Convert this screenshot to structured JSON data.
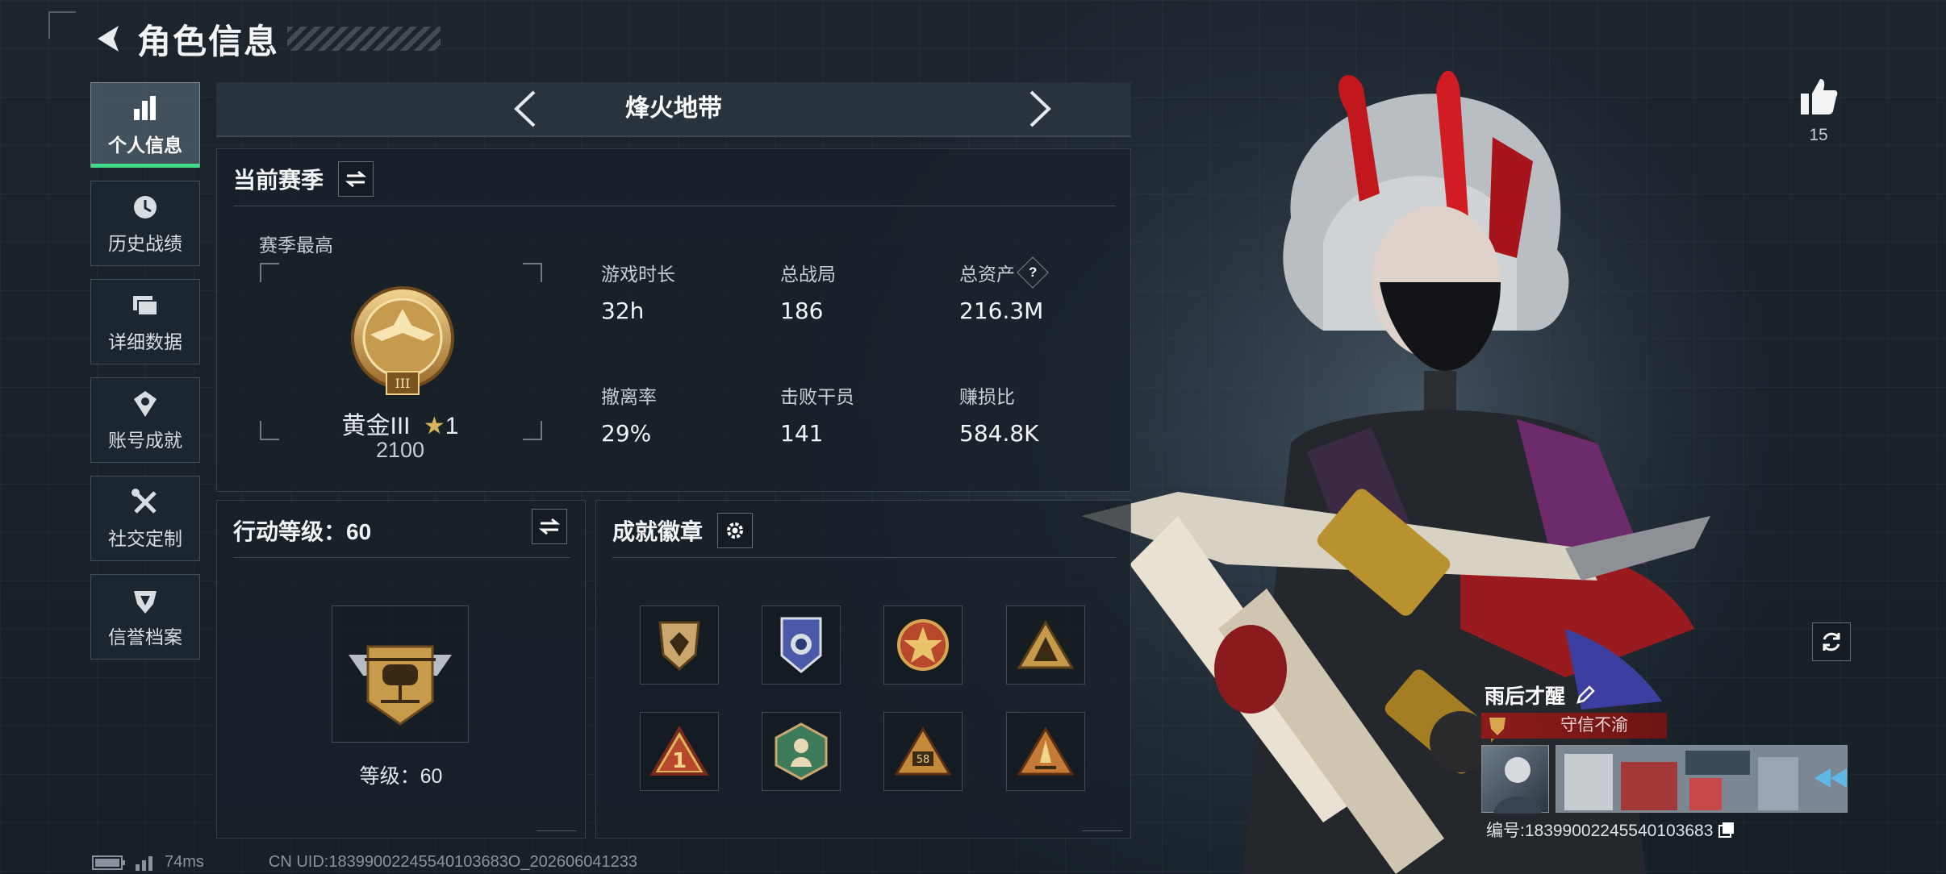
{
  "header": {
    "title": "角色信息"
  },
  "sidebar": {
    "items": [
      {
        "label": "个人信息",
        "icon": "bar-chart-icon",
        "active": true
      },
      {
        "label": "历史战绩",
        "icon": "history-clock-icon"
      },
      {
        "label": "详细数据",
        "icon": "folders-icon"
      },
      {
        "label": "账号成就",
        "icon": "achievement-icon"
      },
      {
        "label": "社交定制",
        "icon": "tools-icon"
      },
      {
        "label": "信誉档案",
        "icon": "credit-shield-icon"
      }
    ]
  },
  "mode": {
    "label": "烽火地带"
  },
  "season": {
    "title": "当前赛季",
    "best_label": "赛季最高",
    "rank_name": "黄金III",
    "rank_stars": "1",
    "rank_score": "2100",
    "stats": [
      {
        "key": "游戏时长",
        "value": "32h"
      },
      {
        "key": "总战局",
        "value": "186"
      },
      {
        "key": "总资产",
        "value": "216.3M",
        "help": true
      },
      {
        "key": "撤离率",
        "value": "29%"
      },
      {
        "key": "击败干员",
        "value": "141"
      },
      {
        "key": "赚损比",
        "value": "584.8K"
      }
    ]
  },
  "action_level": {
    "title": "行动等级：60",
    "level_text": "等级：60"
  },
  "badges": {
    "title": "成就徽章",
    "items": [
      {
        "icon": "shield-badge-icon",
        "color": "#c9a66b"
      },
      {
        "icon": "police-badge-icon",
        "color": "#4a5aa8"
      },
      {
        "icon": "star-emblem-icon",
        "color": "#b8482c"
      },
      {
        "icon": "triangle-badge-icon",
        "color": "#c59a4b"
      },
      {
        "icon": "number-one-badge-icon",
        "color": "#b8482c"
      },
      {
        "icon": "hexagon-badge-icon",
        "color": "#3e7a5c"
      },
      {
        "icon": "triangle-58-badge-icon",
        "color": "#c58b3b"
      },
      {
        "icon": "triangle-rocket-badge-icon",
        "color": "#c57a36"
      }
    ]
  },
  "right": {
    "likes": "15",
    "player_name": "雨后才醒",
    "player_title": "守信不渝",
    "player_id": "编号:18399002245540103683"
  },
  "footer": {
    "ping": "74ms",
    "uid": "CN UID:18399002245540103683O_202606041233"
  },
  "colors": {
    "accent": "#3fdd8c",
    "title_banner": "#8c1c1c"
  }
}
